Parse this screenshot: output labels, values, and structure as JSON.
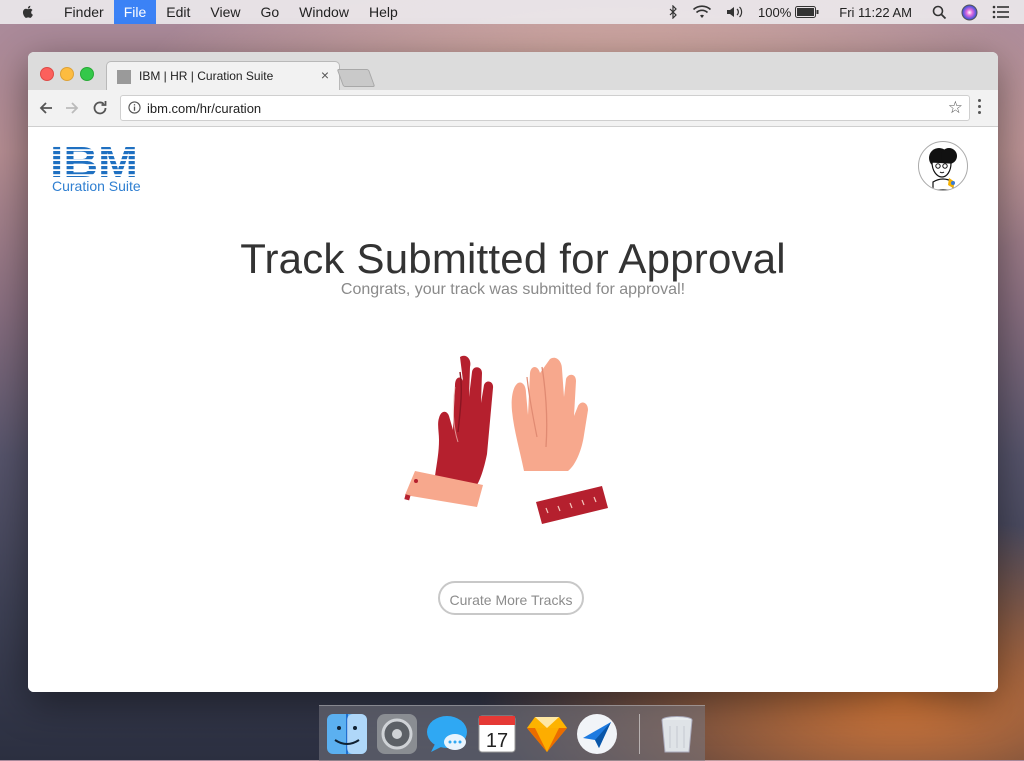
{
  "menubar": {
    "items": [
      "Finder",
      "File",
      "Edit",
      "View",
      "Go",
      "Window",
      "Help"
    ],
    "active_item": "File",
    "battery": "100%",
    "clock": "Fri 11:22 AM"
  },
  "browser": {
    "tab_title": "IBM | HR | Curation Suite",
    "tab_close": "×",
    "url": "ibm.com/hr/curation",
    "star": "☆"
  },
  "page": {
    "logo_text": "IBM",
    "logo_subtitle": "Curation Suite",
    "heading": "Track Submitted for Approval",
    "subheading": "Congrats, your track was submitted for approval!",
    "cta_label": "Curate More Tracks"
  },
  "colors": {
    "ibm_blue": "#1f70c1",
    "glove_red": "#b5202e",
    "skin": "#f7a88d",
    "active_menu": "#3b82f6"
  },
  "dock": {
    "apps": [
      "finder-icon",
      "system-preferences-icon",
      "messages-icon",
      "calendar-icon",
      "sketch-icon",
      "airmail-icon",
      "trash-icon"
    ],
    "calendar_day": "17"
  }
}
